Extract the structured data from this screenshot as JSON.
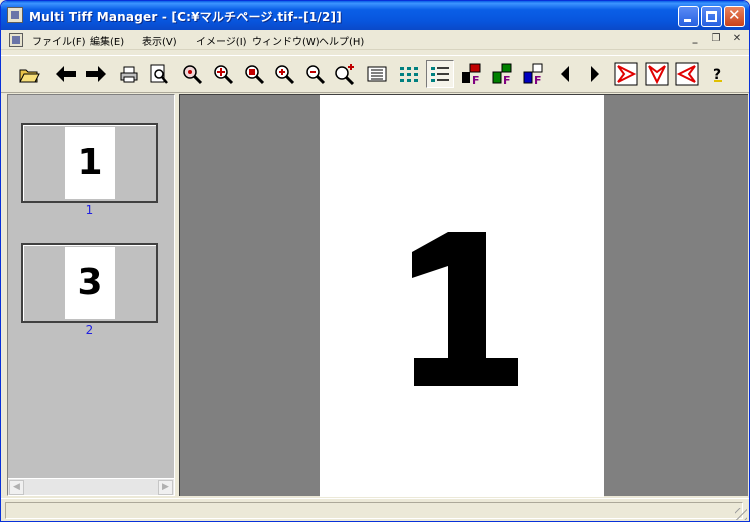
{
  "window": {
    "title": "Multi Tiff Manager - [C:¥マルチページ.tif--[1/2]]"
  },
  "menu": {
    "items": [
      {
        "label": "ファイル(F)"
      },
      {
        "label": "編集(E)"
      },
      {
        "label": "表示(V)"
      },
      {
        "label": "イメージ(I)"
      },
      {
        "label": "ウィンドウ(W)"
      },
      {
        "label": "ヘルプ(H)"
      }
    ]
  },
  "toolbar": {
    "icons": [
      "open-folder-icon",
      "back-arrow-icon",
      "forward-arrow-icon",
      "print-icon",
      "print-preview-icon",
      "zoom-icon",
      "zoom-fit-icon",
      "zoom-actual-icon",
      "zoom-in-icon",
      "zoom-out-icon",
      "zoom-custom-icon",
      "page-list-icon",
      "thumbnail-grid-icon",
      "thumbnail-list-icon",
      "insert-page-icon",
      "replace-page-icon",
      "extract-page-icon",
      "prev-page-icon",
      "next-page-icon",
      "rotate-right-icon",
      "rotate-down-icon",
      "rotate-left-icon",
      "help-icon"
    ]
  },
  "thumbnails": [
    {
      "page_glyph": "1",
      "label": "1"
    },
    {
      "page_glyph": "3",
      "label": "2"
    }
  ],
  "main": {
    "page_glyph": "1"
  },
  "colors": {
    "titlebar": "#0A5FE7",
    "thumb_label": "#2020E0",
    "view_background": "#808080"
  }
}
